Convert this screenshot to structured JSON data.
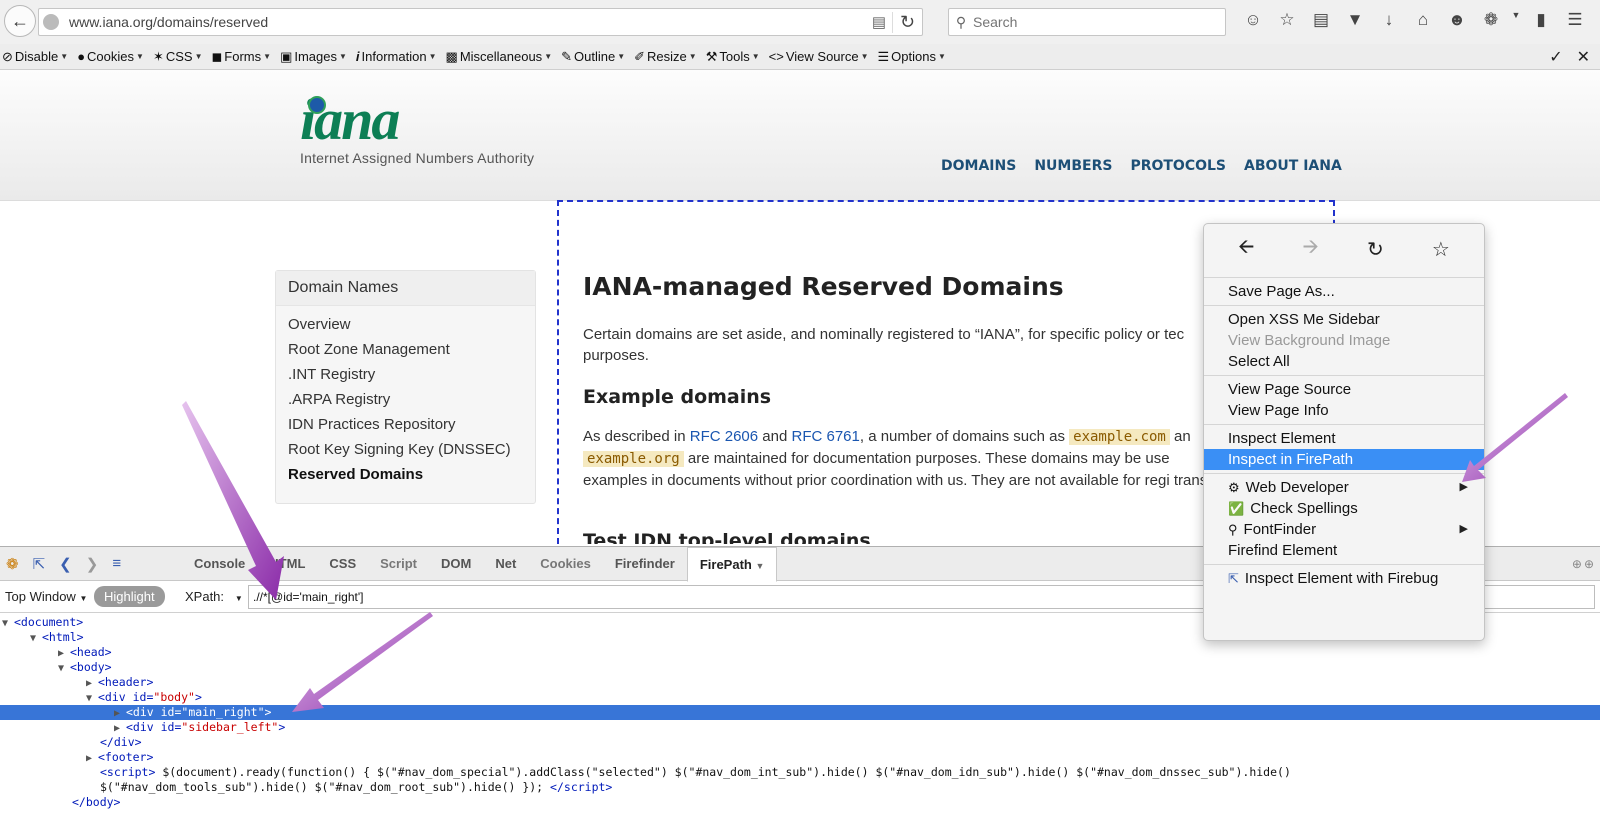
{
  "browser": {
    "url": "www.iana.org/domains/reserved",
    "search_placeholder": "Search"
  },
  "wdtoolbar": {
    "items": [
      {
        "label": "Disable",
        "icon": "no-entry-icon"
      },
      {
        "label": "Cookies",
        "icon": "person-icon"
      },
      {
        "label": "CSS",
        "icon": "wand-icon"
      },
      {
        "label": "Forms",
        "icon": "briefcase-icon"
      },
      {
        "label": "Images",
        "icon": "image-icon"
      },
      {
        "label": "Information",
        "icon": "info-icon"
      },
      {
        "label": "Miscellaneous",
        "icon": "cube-icon"
      },
      {
        "label": "Outline",
        "icon": "pencil-icon"
      },
      {
        "label": "Resize",
        "icon": "brush-icon"
      },
      {
        "label": "Tools",
        "icon": "wrench-icon"
      },
      {
        "label": "View Source",
        "icon": "code-icon"
      },
      {
        "label": "Options",
        "icon": "sliders-icon"
      }
    ]
  },
  "header": {
    "logo_word": "iana",
    "logo_tagline": "Internet Assigned Numbers Authority",
    "nav": [
      "DOMAINS",
      "NUMBERS",
      "PROTOCOLS",
      "ABOUT IANA"
    ]
  },
  "sidebar": {
    "title": "Domain Names",
    "items": [
      "Overview",
      "Root Zone Management",
      ".INT Registry",
      ".ARPA Registry",
      "IDN Practices Repository",
      "Root Key Signing Key (DNSSEC)",
      "Reserved Domains"
    ]
  },
  "main": {
    "title": "IANA-managed Reserved Domains",
    "intro": "Certain domains are set aside, and nominally registered to “IANA”, for specific policy or tec purposes.",
    "h2": "Example domains",
    "p2_a": "As described in ",
    "rfc1": "RFC 2606",
    "p2_and": " and ",
    "rfc2": "RFC 6761",
    "p2_b": ", a number of domains such as ",
    "code1": "example.com",
    "p2_c": " an",
    "code2": "example.org",
    "p2_d": " are maintained for documentation purposes. These domains may be use examples in documents without prior coordination with us. They are not available for regi transfer.",
    "h3": "Test IDN top-level domains"
  },
  "firebug": {
    "tabs": [
      "Console",
      "HTML",
      "CSS",
      "Script",
      "DOM",
      "Net",
      "Cookies",
      "Firefinder",
      "FirePath"
    ],
    "active_tab": "FirePath",
    "top_window": "Top Window",
    "highlight": "Highlight",
    "xpath_label": "XPath:",
    "xpath_value": ".//*[@id='main_right']",
    "script_line1": "$(document).ready(function() { $(\"#nav_dom_special\").addClass(\"selected\") $(\"#nav_dom_int_sub\").hide() $(\"#nav_dom_idn_sub\").hide() $(\"#nav_dom_dnssec_sub\").hide()",
    "script_line2": "$(\"#nav_dom_tools_sub\").hide() $(\"#nav_dom_root_sub\").hide() });"
  },
  "context_menu": {
    "items": [
      {
        "label": "Save Page As...",
        "group": 1
      },
      {
        "label": "Open XSS Me Sidebar",
        "group": 2
      },
      {
        "label": "View Background Image",
        "group": 2,
        "disabled": true
      },
      {
        "label": "Select All",
        "group": 2
      },
      {
        "label": "View Page Source",
        "group": 3
      },
      {
        "label": "View Page Info",
        "group": 3
      },
      {
        "label": "Inspect Element",
        "group": 4
      },
      {
        "label": "Inspect in FirePath",
        "group": 4,
        "highlighted": true
      },
      {
        "label": "Web Developer",
        "group": 5,
        "icon": "gear-icon",
        "submenu": true
      },
      {
        "label": "Check Spellings",
        "group": 5,
        "icon": "checkmark-icon"
      },
      {
        "label": "FontFinder",
        "group": 5,
        "icon": "magnifier-icon",
        "submenu": true
      },
      {
        "label": "Firefind Element",
        "group": 5
      },
      {
        "label": "Inspect Element with Firebug",
        "group": 6,
        "icon": "firebug-inspect-icon"
      }
    ]
  },
  "colors": {
    "accent_blue": "#3a8ff5",
    "selection_blue": "#3875d7",
    "arrow_purple": "#9b3fb5",
    "iana_green": "#0d7f55",
    "nav_blue": "#1d4f76"
  }
}
